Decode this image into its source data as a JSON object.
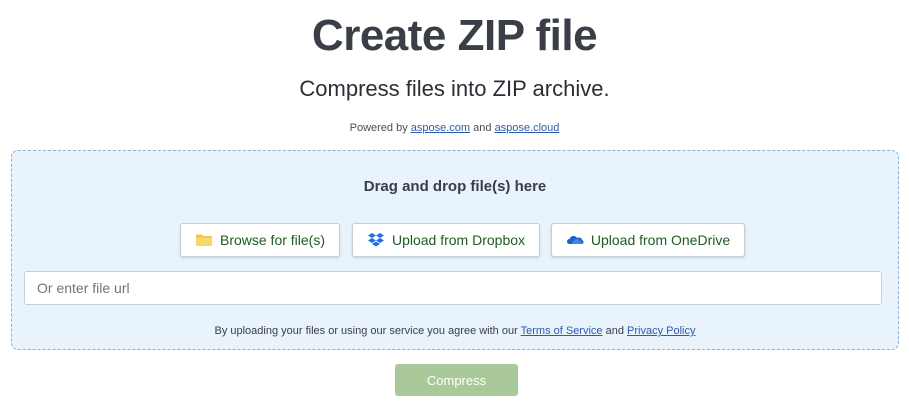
{
  "header": {
    "title": "Create ZIP file",
    "subtitle": "Compress files into ZIP archive.",
    "powered_prefix": "Powered by",
    "powered_link1": "aspose.com",
    "powered_and": "and",
    "powered_link2": "aspose.cloud"
  },
  "upload": {
    "drop_title": "Drag and drop file(s) here",
    "browse_label": "Browse for file(s)",
    "dropbox_label": "Upload from Dropbox",
    "onedrive_label": "Upload from OneDrive",
    "url_placeholder": "Or enter file url",
    "url_value": "",
    "terms_prefix": "By uploading your files or using our service you agree with our",
    "terms_link": "Terms of Service",
    "terms_and": "and",
    "privacy_link": "Privacy Policy"
  },
  "actions": {
    "compress_label": "Compress"
  },
  "icons": {
    "browse": "folder-icon",
    "dropbox": "dropbox-icon",
    "onedrive": "onedrive-icon"
  },
  "colors": {
    "accent_link": "#2e5aac",
    "button_text": "#1f5c1f",
    "dropzone_bg": "#e8f3fc",
    "compress_bg": "#a9c99a",
    "folder": "#f5c842",
    "dropbox": "#1e6fe0",
    "onedrive": "#1a62c9"
  }
}
